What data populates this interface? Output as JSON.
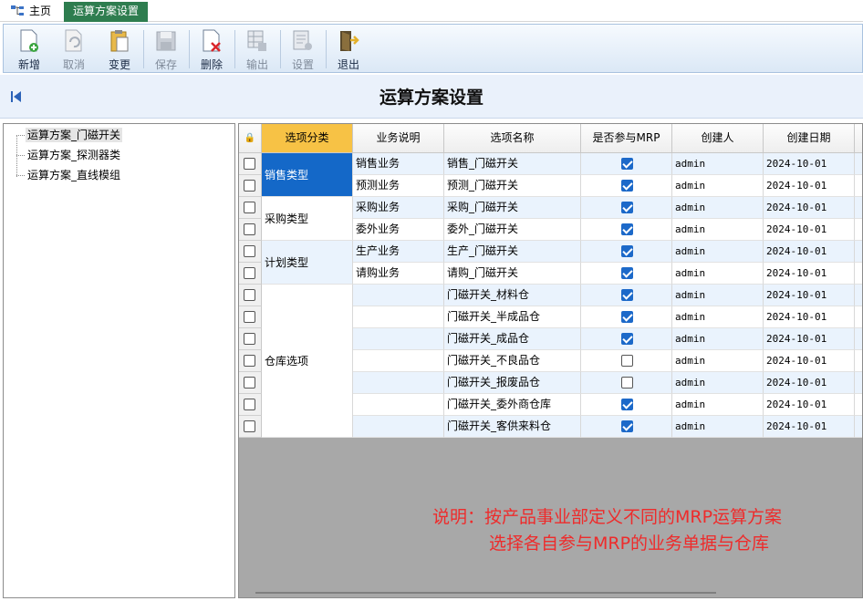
{
  "tabs": {
    "home": "主页",
    "active": "运算方案设置"
  },
  "toolbar": {
    "new": "新增",
    "cancel": "取消",
    "change": "变更",
    "save": "保存",
    "delete": "删除",
    "export": "输出",
    "settings": "设置",
    "exit": "退出"
  },
  "page_title": "运算方案设置",
  "tree": {
    "items": [
      "运算方案_门磁开关",
      "运算方案_探测器类",
      "运算方案_直线模组"
    ]
  },
  "grid": {
    "headers": {
      "category": "选项分类",
      "biz_desc": "业务说明",
      "option_name": "选项名称",
      "mrp": "是否参与MRP",
      "creator": "创建人",
      "created_date": "创建日期"
    },
    "categories": [
      "销售类型",
      "采购类型",
      "计划类型",
      "仓库选项"
    ],
    "rows": [
      {
        "biz": "销售业务",
        "name": "销售_门磁开关",
        "mrp": true,
        "creator": "admin",
        "date": "2024-10-01"
      },
      {
        "biz": "预测业务",
        "name": "预测_门磁开关",
        "mrp": true,
        "creator": "admin",
        "date": "2024-10-01"
      },
      {
        "biz": "采购业务",
        "name": "采购_门磁开关",
        "mrp": true,
        "creator": "admin",
        "date": "2024-10-01"
      },
      {
        "biz": "委外业务",
        "name": "委外_门磁开关",
        "mrp": true,
        "creator": "admin",
        "date": "2024-10-01"
      },
      {
        "biz": "生产业务",
        "name": "生产_门磁开关",
        "mrp": true,
        "creator": "admin",
        "date": "2024-10-01"
      },
      {
        "biz": "请购业务",
        "name": "请购_门磁开关",
        "mrp": true,
        "creator": "admin",
        "date": "2024-10-01"
      },
      {
        "biz": "",
        "name": "门磁开关_材料仓",
        "mrp": true,
        "creator": "admin",
        "date": "2024-10-01"
      },
      {
        "biz": "",
        "name": "门磁开关_半成品仓",
        "mrp": true,
        "creator": "admin",
        "date": "2024-10-01"
      },
      {
        "biz": "",
        "name": "门磁开关_成品仓",
        "mrp": true,
        "creator": "admin",
        "date": "2024-10-01"
      },
      {
        "biz": "",
        "name": "门磁开关_不良品仓",
        "mrp": false,
        "creator": "admin",
        "date": "2024-10-01"
      },
      {
        "biz": "",
        "name": "门磁开关_报废品仓",
        "mrp": false,
        "creator": "admin",
        "date": "2024-10-01"
      },
      {
        "biz": "",
        "name": "门磁开关_委外商仓库",
        "mrp": true,
        "creator": "admin",
        "date": "2024-10-01"
      },
      {
        "biz": "",
        "name": "门磁开关_客供来料仓",
        "mrp": true,
        "creator": "admin",
        "date": "2024-10-01"
      }
    ]
  },
  "note": {
    "line1": "说明：按产品事业部定义不同的MRP运算方案",
    "line2": "选择各自参与MRP的业务单据与仓库"
  },
  "colors": {
    "active_tab": "#2e7d4f",
    "selected_cell": "#1468c8",
    "header_selected": "#f7c245",
    "note_text": "#ee2b2b"
  }
}
